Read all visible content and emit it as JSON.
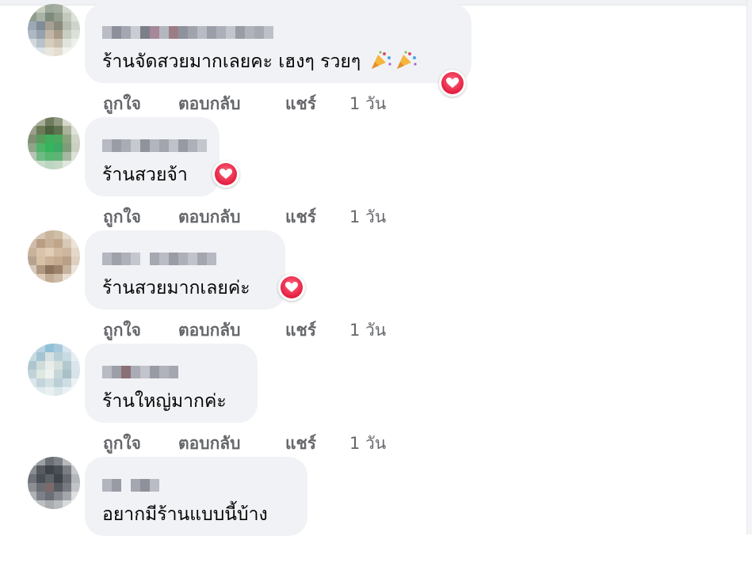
{
  "actions": {
    "like": "ถูกใจ",
    "reply": "ตอบกลับ",
    "share": "แชร์"
  },
  "comments": [
    {
      "text": "ร้านจัดสวยมากเลยคะ เฮงๆ รวยๆ",
      "time": "1 วัน",
      "reaction": "heart",
      "emojis": [
        "party-popper-icon",
        "party-popper-icon"
      ]
    },
    {
      "text": "ร้านสวยจ้า",
      "time": "1 วัน",
      "reaction": "heart"
    },
    {
      "text": "ร้านสวยมากเลยค่ะ",
      "time": "1 วัน",
      "reaction": "heart"
    },
    {
      "text": "ร้านใหญ่มากค่ะ",
      "time": "1 วัน"
    },
    {
      "text": "อยากมีร้านแบบนี้บ้าง"
    }
  ],
  "colors": {
    "bubble": "#f0f2f5",
    "text": "#050505",
    "meta": "#65676b",
    "heart": "#e41e3f"
  }
}
